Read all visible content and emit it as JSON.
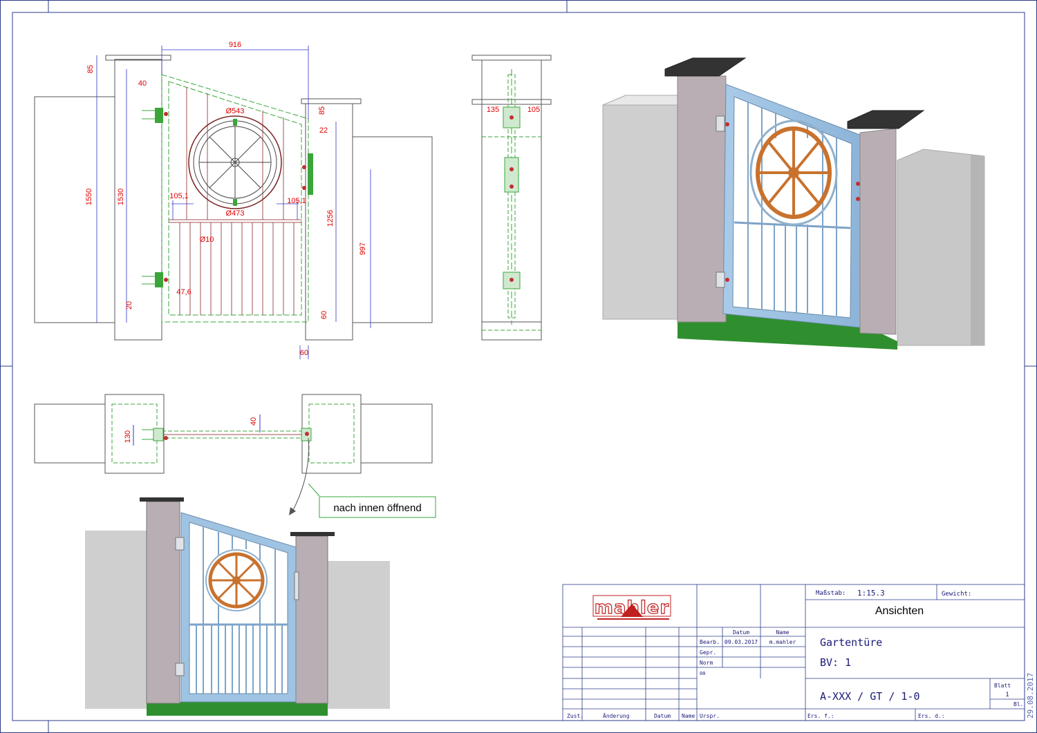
{
  "drawing": {
    "dimensions": {
      "total_width": "916",
      "top_overhang": "85",
      "stile_width": "40",
      "wheel_outer_diameter": "Ø543",
      "right_post_overhang": "85",
      "top_gap": "22",
      "total_height": "1550",
      "gate_height": "1530",
      "wheel_offset_left": "105,1",
      "wheel_offset_right": "105,1",
      "wheel_inner_diameter": "Ø473",
      "post_height": "1256",
      "bar_diameter": "Ø10",
      "lower_height": "997",
      "bar_spacing": "47,6",
      "bottom_gap": "20",
      "bottom_rail": "60",
      "post_offset": "60",
      "side_left": "135",
      "side_right": "105",
      "plan_depth": "130",
      "plan_thickness": "40"
    },
    "annotation": "nach innen öffnend"
  },
  "colors": {
    "frame": "#9fc3e3",
    "post": "#b9aeb3",
    "wall": "#cfcfcf",
    "cap": "#333333",
    "base": "#2f8f2f",
    "wheel": "#c8722e",
    "dimension": "#e00000",
    "hidden_line": "#3aa63a"
  },
  "title_block": {
    "logo": "mahler",
    "scale_label": "Maßstab:",
    "scale_value": "1:15.3",
    "weight_label": "Gewicht:",
    "sheet_title": "Ansichten",
    "col_date": "Datum",
    "col_name": "Name",
    "row_bearb": "Bearb.",
    "row_gepr": "Gepr.",
    "row_norm": "Norm",
    "row_extra": "00",
    "bearb_date": "09.03.2017",
    "bearb_name": "m.mahler",
    "description_1": "Gartentüre",
    "description_2": "BV: 1",
    "drawing_number": "A-XXX / GT / 1-0",
    "sheet_label": "Blatt",
    "sheet_number": "1",
    "sheet_total": "Bl.",
    "footer_zust": "Zust.",
    "footer_aenderung": "Änderung",
    "footer_datum": "Datum",
    "footer_name": "Name",
    "footer_ursprung": "Urspr.",
    "footer_ersatz_fuer": "Ers. f.:",
    "footer_ersetzt_durch": "Ers. d.:"
  },
  "plot_date": "29.08.2017"
}
